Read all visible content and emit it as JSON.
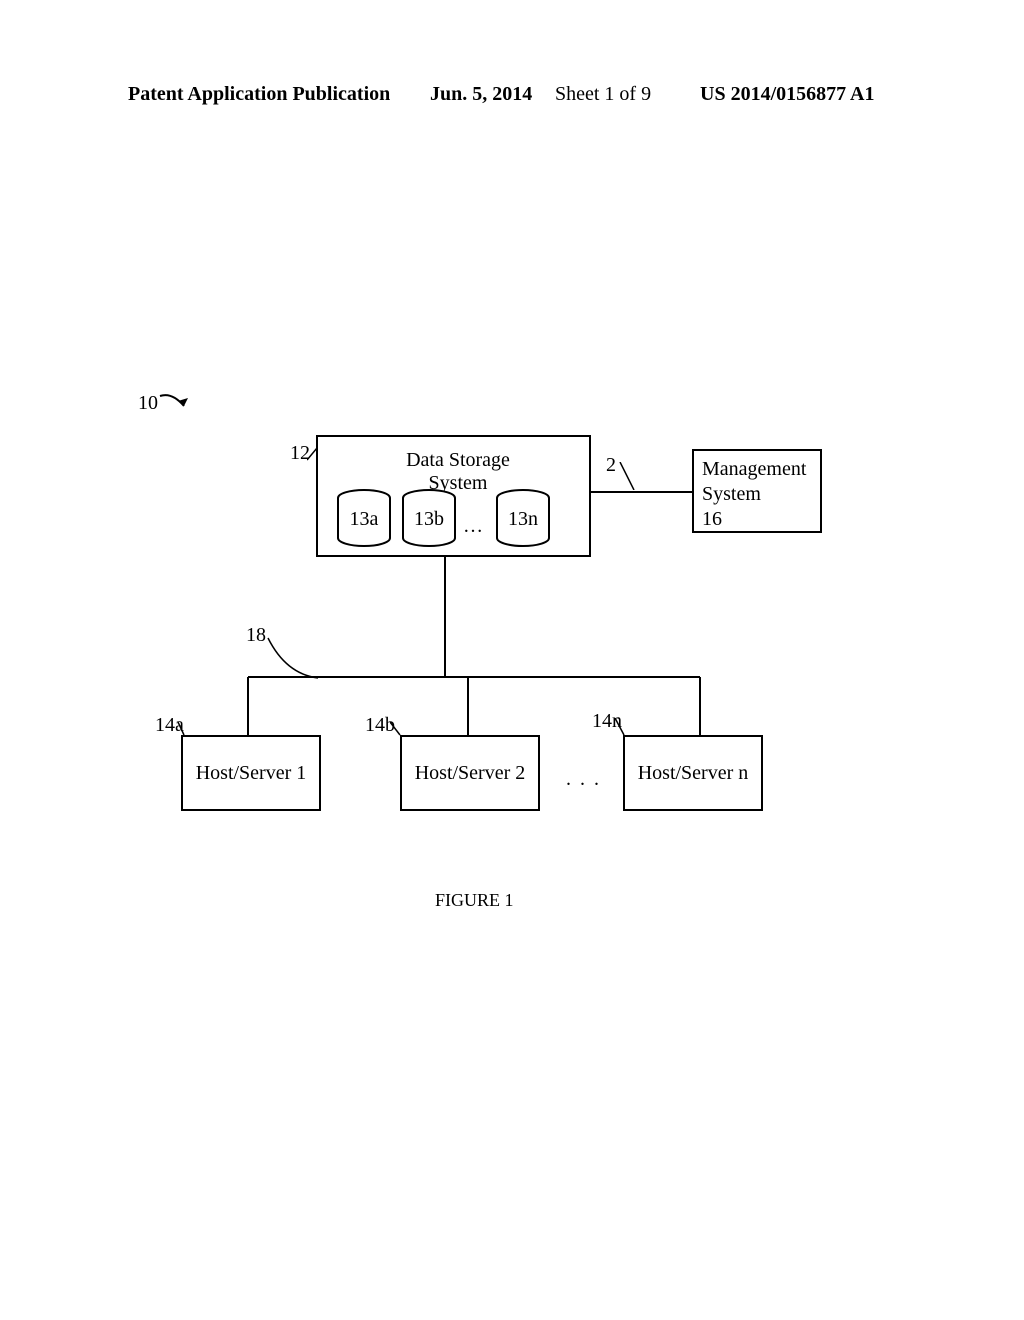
{
  "header": {
    "left": "Patent Application Publication",
    "date": "Jun. 5, 2014",
    "sheet": "Sheet 1 of 9",
    "pubnum": "US 2014/0156877 A1"
  },
  "refs": {
    "system": "10",
    "dss": "12",
    "mgmt_link": "2",
    "bus": "18",
    "host1": "14a",
    "host2": "14b",
    "hostn": "14n",
    "disk_a": "13a",
    "disk_b": "13b",
    "disk_n": "13n"
  },
  "blocks": {
    "dss_title": "Data Storage System",
    "mgmt_line1": "Management",
    "mgmt_line2": "System",
    "mgmt_line3": "16",
    "host1": "Host/Server 1",
    "host2": "Host/Server 2",
    "hostn": "Host/Server n"
  },
  "misc": {
    "disk_dots": "…",
    "host_dots": ". . .",
    "figure": "FIGURE 1"
  }
}
